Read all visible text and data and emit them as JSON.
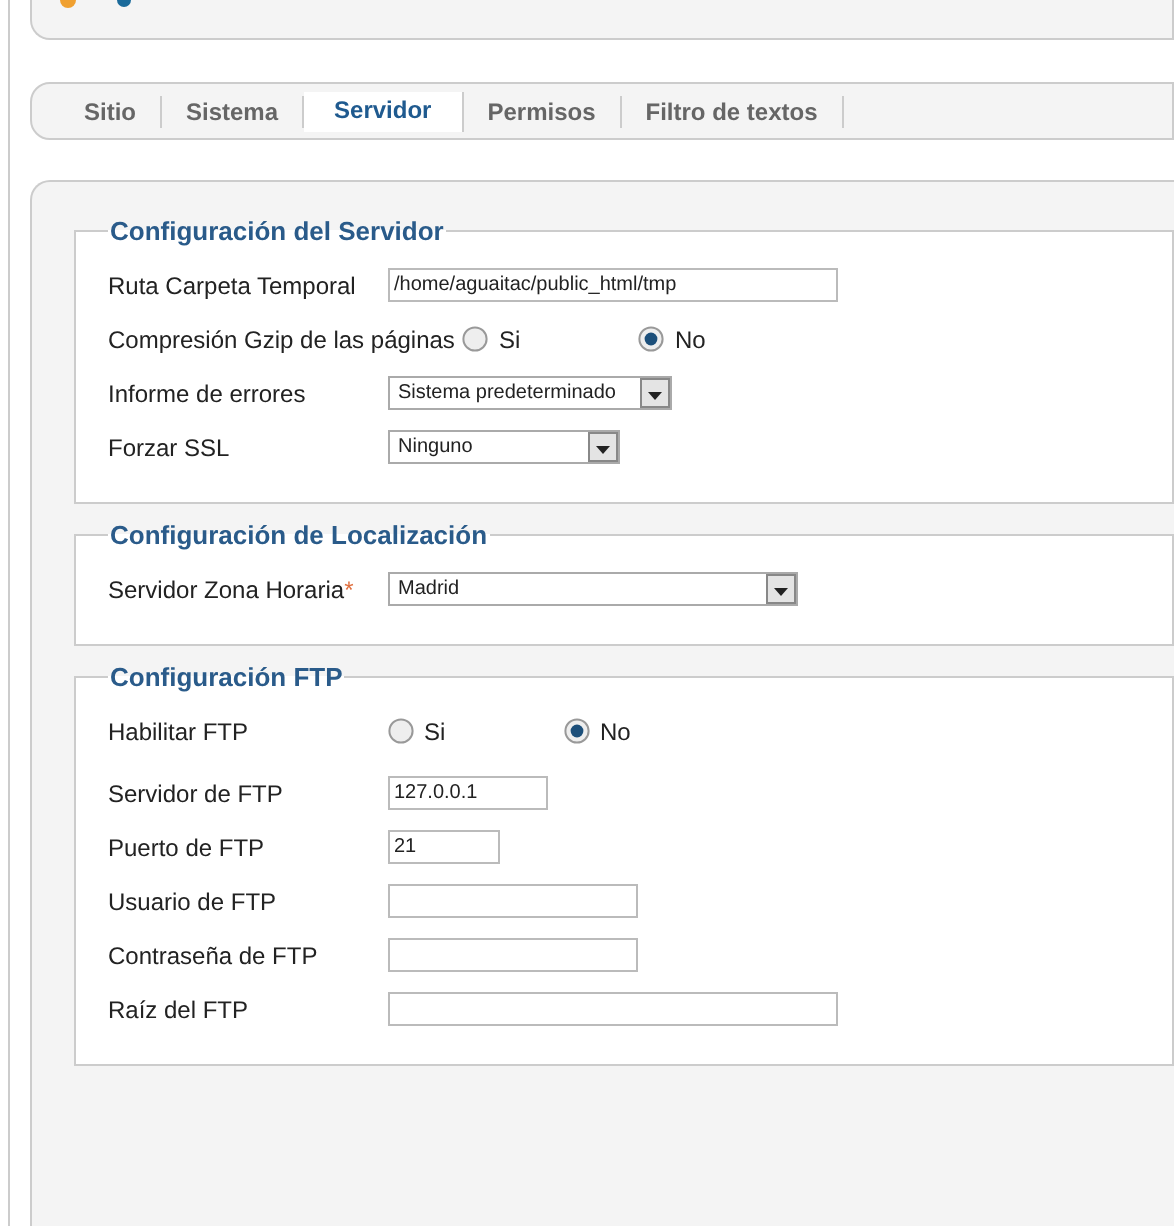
{
  "tabs": [
    {
      "label": "Sitio",
      "selected": false
    },
    {
      "label": "Sistema",
      "selected": false
    },
    {
      "label": "Servidor",
      "selected": true
    },
    {
      "label": "Permisos",
      "selected": false
    },
    {
      "label": "Filtro de textos",
      "selected": false
    }
  ],
  "sections": [
    {
      "title": "Configuración del Servidor",
      "fields": [
        {
          "kind": "text",
          "label": "Ruta Carpeta Temporal",
          "value": "/home/aguaitac/public_html/tmp"
        },
        {
          "kind": "radio",
          "label": "Compresión Gzip de las páginas",
          "options": [
            {
              "label": "Si",
              "selected": false
            },
            {
              "label": "No",
              "selected": true
            }
          ]
        },
        {
          "kind": "select",
          "label": "Informe de errores",
          "value": "Sistema predeterminado"
        },
        {
          "kind": "select",
          "label": "Forzar SSL",
          "value": "Ninguno"
        }
      ]
    },
    {
      "title": "Configuración de Localización",
      "fields": [
        {
          "kind": "select",
          "label": "Servidor Zona Horaria",
          "required_mark": "*",
          "value": "Madrid"
        }
      ]
    },
    {
      "title": "Configuración FTP",
      "fields": [
        {
          "kind": "radio",
          "label": "Habilitar FTP",
          "options": [
            {
              "label": "Si",
              "selected": false
            },
            {
              "label": "No",
              "selected": true
            }
          ]
        },
        {
          "kind": "text",
          "label": "Servidor de FTP",
          "value": "127.0.0.1"
        },
        {
          "kind": "text",
          "label": "Puerto de FTP",
          "value": "21"
        },
        {
          "kind": "text",
          "label": "Usuario de FTP"
        },
        {
          "kind": "text",
          "label": "Contraseña de FTP"
        },
        {
          "kind": "text",
          "label": "Raíz del FTP"
        }
      ]
    }
  ]
}
